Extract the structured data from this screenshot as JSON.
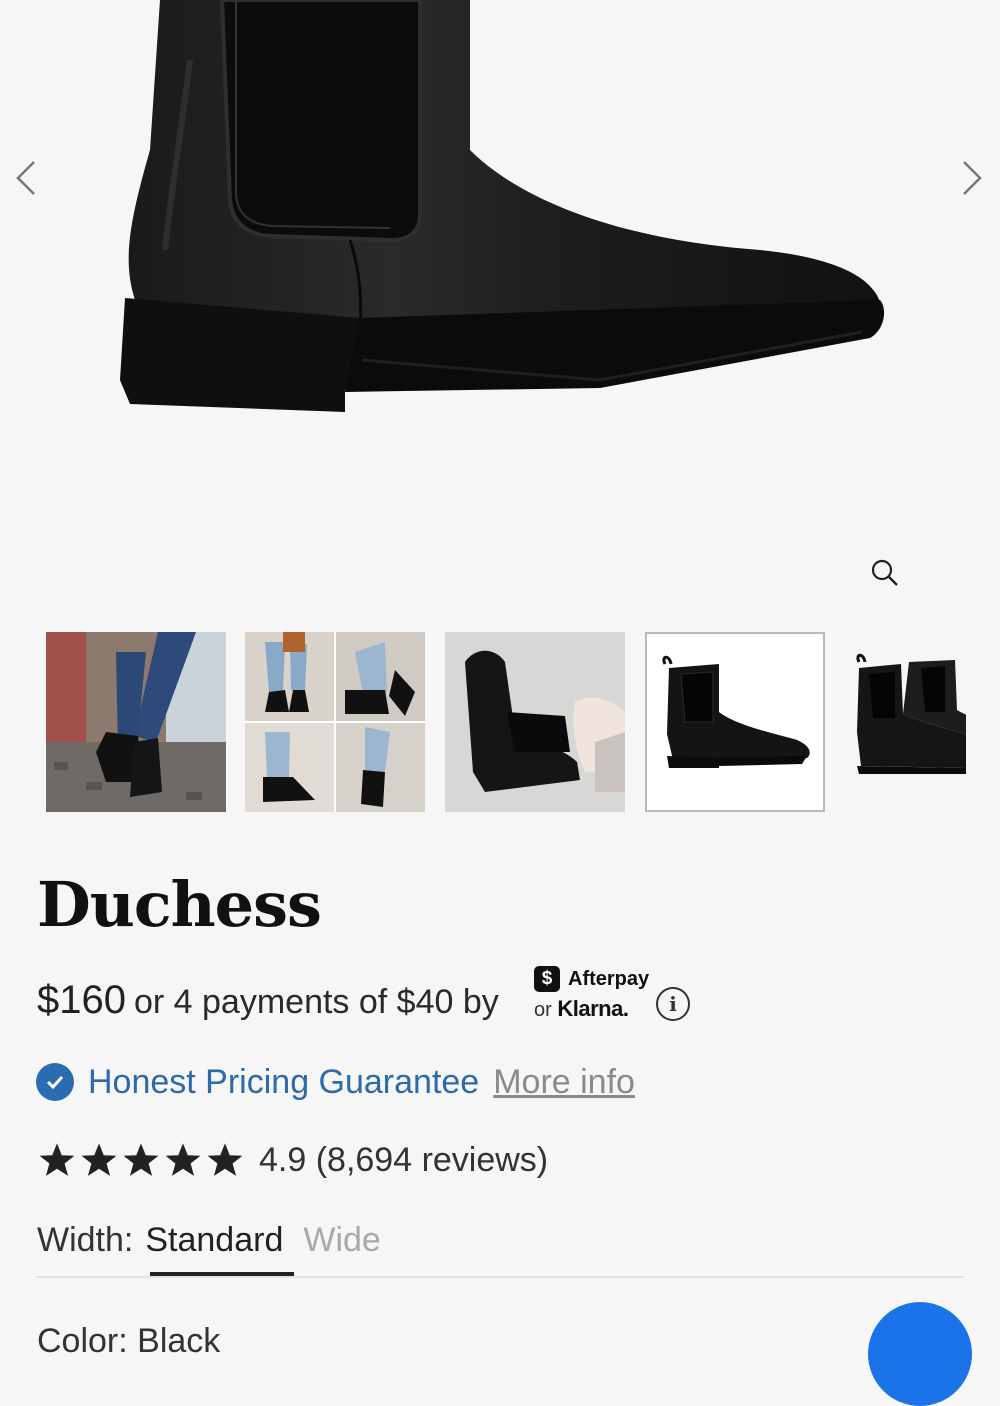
{
  "gallery": {
    "prev_icon": "chevron-left-icon",
    "next_icon": "chevron-right-icon",
    "zoom_icon": "magnifier-icon",
    "thumbnails": [
      {
        "alt": "street-style-thumbnail",
        "active": false
      },
      {
        "alt": "collage-thumbnail",
        "active": false
      },
      {
        "alt": "pull-on-thumbnail",
        "active": false
      },
      {
        "alt": "side-profile-thumbnail",
        "active": true
      },
      {
        "alt": "pair-thumbnail",
        "active": false
      }
    ]
  },
  "product": {
    "title": "Duchess",
    "price": "$160",
    "installments": "or 4 payments of $40 by",
    "afterpay_label": "Afterpay",
    "afterpay_badge": "$",
    "klarna_prefix": "or",
    "klarna_label": "Klarna.",
    "info_glyph": "i",
    "guarantee": "Honest Pricing Guarantee",
    "more_info": "More info",
    "rating": {
      "stars": 5,
      "text": "4.9 (8,694 reviews)"
    },
    "width": {
      "label": "Width:",
      "options": [
        "Standard",
        "Wide"
      ],
      "selected": "Standard"
    },
    "next_row_peek": "Color: Black"
  },
  "colors": {
    "accent_blue": "#2c6aa8",
    "chat_blue": "#1a73e8",
    "background": "#f6f6f6"
  }
}
